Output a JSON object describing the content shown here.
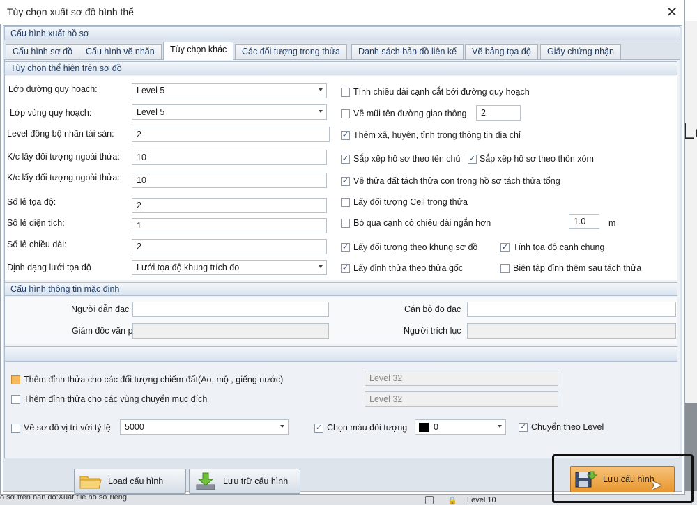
{
  "dialog": {
    "title": "Tùy chọn xuất sơ đồ hình thể",
    "close_symbol": "✕"
  },
  "sections": {
    "export_config": "Cấu hình xuất hồ sơ",
    "display_options": "Tùy chọn thể hiện trên sơ đồ",
    "default_info": "Cấu hình thông tin mặc định"
  },
  "tabs": [
    {
      "label": "Cấu hình sơ đồ"
    },
    {
      "label": "Cấu hình vẽ nhãn"
    },
    {
      "label": "Tùy chọn khác"
    },
    {
      "label": "Các đối tượng trong thửa"
    },
    {
      "label": "Danh sách bản đồ liên kế"
    },
    {
      "label": "Vẽ bảng tọa độ"
    },
    {
      "label": "Giấy chứng nhận"
    }
  ],
  "left_fields": [
    {
      "label": "Lớp đường quy hoạch:",
      "value": "Level 5"
    },
    {
      "label": "Lớp vùng quy hoạch:",
      "value": "Level 5"
    },
    {
      "label": "Level đồng bộ nhãn tài sản:",
      "value": "2"
    },
    {
      "label": "K/c lấy đối tượng ngoài thửa:",
      "value": "10"
    },
    {
      "label": "K/c lấy đối tượng ngoài thửa:",
      "value": "10"
    },
    {
      "label": "Số lẻ tọa độ:",
      "value": "2"
    },
    {
      "label": "Số lẻ diện tích:",
      "value": "1"
    },
    {
      "label": "Số lẻ chiều dài:",
      "value": "2"
    },
    {
      "label": "Định dạng lưới tọa độ",
      "value": "Lưới tọa độ khung trích đo"
    }
  ],
  "right_options": {
    "cut_edge": "Tính chiều dài cạnh cắt bởi đường quy hoạch",
    "traffic_arrow": "Vẽ mũi tên đường giao thông",
    "traffic_arrow_value": "2",
    "add_address": "Thêm xã, huyện, tỉnh trong thông tin địa chỉ",
    "sort_owner": "Sắp xếp hồ sơ theo tên chủ",
    "sort_village": "Sắp xếp hồ sơ theo thôn xóm",
    "draw_split": "Vẽ thửa đất tách thửa con trong hồ sơ tách thửa tổng",
    "cell_object": "Lấy đối tượng Cell trong thửa",
    "skip_short": "Bỏ qua cạnh có chiều dài ngắn hơn",
    "skip_short_value": "1.0",
    "skip_short_unit": "m",
    "frame_object": "Lấy đối tượng theo khung sơ đồ",
    "common_edge": "Tính tọa độ cạnh chung",
    "origin_vertex": "Lấy đỉnh thửa theo thửa gốc",
    "edit_vertex": "Biên tập đỉnh thêm sau tách thửa"
  },
  "info_fields": {
    "guide_label": "Người dẫn đạc",
    "guide_value": "",
    "surveyor_label": "Cán bộ đo đạc",
    "surveyor_value": "",
    "director_label": "Giám đốc văn phòng",
    "director_value": "",
    "extractor_label": "Người trích lục",
    "extractor_value": ""
  },
  "bottom_options": {
    "add_vertex_occupy": "Thêm đỉnh thửa cho các đối tượng chiếm đất(Ao, mộ , giếng nước)",
    "add_vertex_occupy_level": "Level 32",
    "add_vertex_purpose": "Thêm đỉnh thửa cho các vùng chuyển mục đích",
    "add_vertex_purpose_level": "Level 32",
    "draw_position": "Vẽ sơ đồ vị trí với tỷ lệ",
    "scale_value": "5000",
    "choose_color": "Chọn màu đối tượng",
    "color_value": "0",
    "move_level": "Chuyển theo Level"
  },
  "buttons": {
    "load": "Load cấu hình",
    "store": "Lưu trữ cấu hình",
    "save": "Lưu cấu hình"
  },
  "background": {
    "bottom_text": "ồ sơ trên bản đồ:Xuất file hồ sơ riêng",
    "status_level": "Level 10",
    "right_text": "Le"
  },
  "colors": {
    "accent": "#1f3c66",
    "save_button": "#e8972e",
    "panel_bg": "#dde4ec"
  }
}
